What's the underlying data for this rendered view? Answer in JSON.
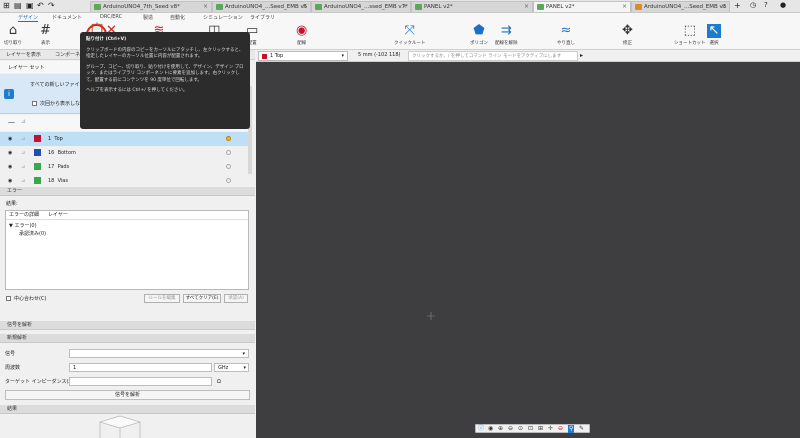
{
  "window_tabs": [
    {
      "label": "ArduinoUNO4_7th_Seed v8*",
      "icon": "green"
    },
    {
      "label": "ArduinoUNO4_...Seed_EMB v5",
      "icon": "green"
    },
    {
      "label": "ArduinoUNO4_...ssed_EMB v7*",
      "icon": "green"
    },
    {
      "label": "PANEL v2*",
      "icon": "green"
    },
    {
      "label": "PANEL v2*",
      "icon": "green",
      "active": true
    },
    {
      "label": "ArduinoUNO4_...Seed_EMB v3",
      "icon": "orange"
    }
  ],
  "ribbon_tabs": [
    "デザイン",
    "ドキュメント",
    "DRC/ERC",
    "製造",
    "自動化",
    "シミュレーション",
    "ライブラリ"
  ],
  "ribbon_groups": {
    "cut_paste": "切り取り",
    "show": "表示",
    "layer": "レイヤー",
    "guide": "ガイド形状",
    "place": "配置",
    "wire": "配線",
    "quickroute": "クイックルート",
    "polygon": "ポリゴン",
    "unroute": "配線を解除",
    "redo": "やり直し",
    "modify": "修正",
    "shortcut": "ショートカット",
    "select": "選択"
  },
  "panel_tabs": [
    "レイヤーを表示",
    "コンポーネント"
  ],
  "layer_set_label": "レイヤー セット",
  "info": {
    "text": "すべての新しいファイルの既定の表示は...です。詳細は、ここを参照してください。",
    "checkbox_label": "次回から表示しない"
  },
  "layers": [
    {
      "num": "1",
      "name": "Top",
      "color": "#c8102e",
      "selected": true
    },
    {
      "num": "16",
      "name": "Bottom",
      "color": "#1f4fb4"
    },
    {
      "num": "17",
      "name": "Pads",
      "color": "#3aa84a"
    },
    {
      "num": "18",
      "name": "Vias",
      "color": "#3aa84a"
    }
  ],
  "error_section": "エラー",
  "result_label": "結果:",
  "error_table": {
    "col1": "エラーの詳細",
    "col2": "レイヤー",
    "row1": "エラー(0)",
    "row2": "承認済み(0)"
  },
  "center_check": "中心合わせ(C)",
  "buttons": {
    "rule_edit": "ルールを編集",
    "clear_all": "すべてクリア(E)",
    "approve": "承認(A)",
    "analyze": "信号を解析"
  },
  "signal_section": "信号を解析",
  "new_analysis": "新規解析",
  "fields": {
    "signal": "信号",
    "freq": "周波数",
    "freq_value": "1",
    "freq_unit": "GHz",
    "target": "ターゲット インピーダンス(Z0)",
    "target_unit": "Ω"
  },
  "result_section": "結果",
  "canvas_top": {
    "layer": "1 Top",
    "grid": "5 mm (-102 118)",
    "cmd_placeholder": "クリックするか、/ を押してコマンド ライン モードをアクティブにします"
  },
  "tooltip": {
    "title": "貼り付け (Ctrl+V)",
    "p1": "クリップボードの内容のコピーをカーソルにアタッチし、左クリックすると、指定したレイヤーのカーソル位置に内容が配置されます。",
    "p2": "グループ、コピー、切り取り、貼り付けを使用して、デザイン、デザイン ブロック、またはライブラリ コンポーネントに要素を追加します。右クリックして、配置する前にコンテンツを 90 度単位で回転します。",
    "p3": "ヘルプを表示するには Ctrl+/ を押してください。"
  }
}
